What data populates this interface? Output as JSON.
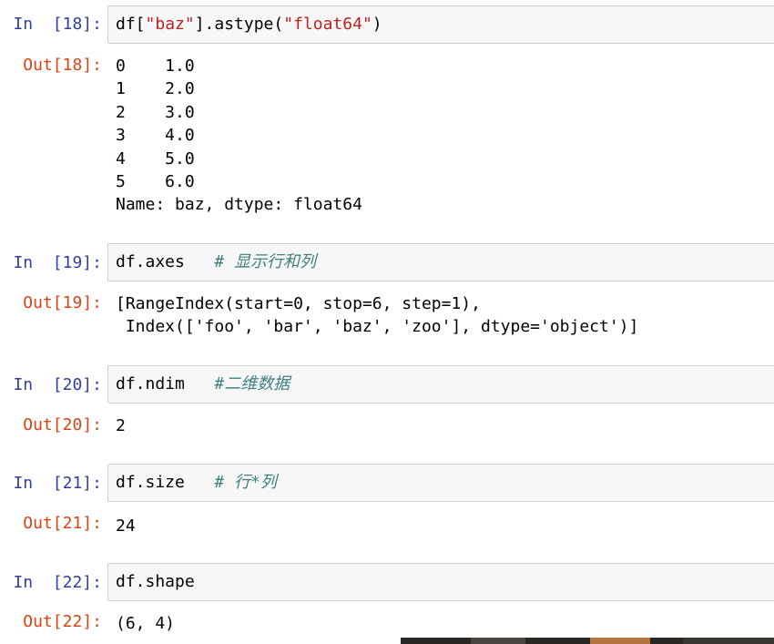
{
  "cells": [
    {
      "in_prompt": "In  [18]:",
      "code_plain_1": "df[",
      "code_str_1": "\"baz\"",
      "code_plain_2": "].astype(",
      "code_str_2": "\"float64\"",
      "code_plain_3": ")",
      "out_prompt": "Out[18]:",
      "output_lines": [
        "0    1.0",
        "1    2.0",
        "2    3.0",
        "3    4.0",
        "4    5.0",
        "5    6.0",
        "Name: baz, dtype: float64"
      ]
    },
    {
      "in_prompt": "In  [19]:",
      "code": "df.axes   ",
      "comment": "# 显示行和列",
      "out_prompt": "Out[19]:",
      "output_lines": [
        "[RangeIndex(start=0, stop=6, step=1),",
        " Index(['foo', 'bar', 'baz', 'zoo'], dtype='object')]"
      ]
    },
    {
      "in_prompt": "In  [20]:",
      "code": "df.ndim   ",
      "comment": "#二维数据",
      "out_prompt": "Out[20]:",
      "output_lines": [
        "2"
      ]
    },
    {
      "in_prompt": "In  [21]:",
      "code": "df.size   ",
      "comment": "# 行*列",
      "out_prompt": "Out[21]:",
      "output_lines": [
        "24"
      ]
    },
    {
      "in_prompt": "In  [22]:",
      "code": "df.shape",
      "out_prompt": "Out[22]:",
      "output_lines": [
        "(6, 4)"
      ]
    }
  ],
  "colors": {
    "in_prompt": "#303f9f",
    "out_prompt": "#d84315",
    "string": "#ba2121",
    "comment": "#408080",
    "input_bg": "#f7f7f7"
  }
}
